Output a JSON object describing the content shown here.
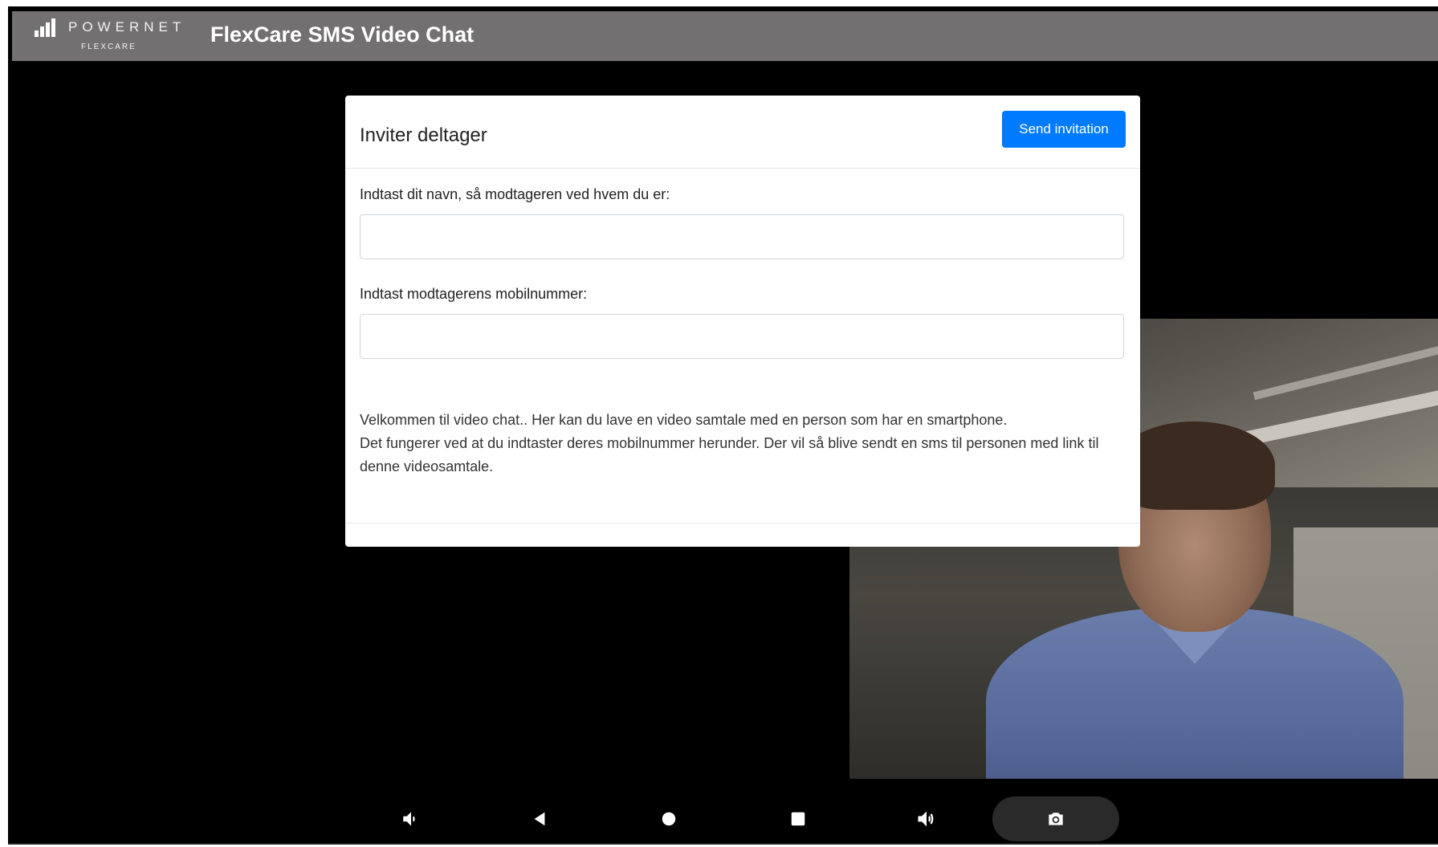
{
  "header": {
    "brand_name": "POWERNET",
    "brand_sub": "FLEXCARE",
    "app_title": "FlexCare SMS Video Chat"
  },
  "dialog": {
    "title": "Inviter deltager",
    "send_button_label": "Send invitation",
    "name_label": "Indtast dit navn, så modtageren ved hvem du er:",
    "name_value": "",
    "phone_label": "Indtast modtagerens mobilnummer:",
    "phone_value": "",
    "description_lines": [
      "Velkommen til video chat.. Her kan du lave en video samtale med en person som har en smartphone.",
      "Det fungerer ved at du indtaster deres mobilnummer herunder. Der vil så blive sendt en sms til personen med link til",
      "denne videosamtale."
    ]
  },
  "navbar": {
    "buttons": [
      {
        "name": "volume-down-icon",
        "glyph": "🔈"
      },
      {
        "name": "back-icon",
        "glyph": "◀"
      },
      {
        "name": "home-icon",
        "glyph": "●"
      },
      {
        "name": "recents-icon",
        "glyph": "■"
      },
      {
        "name": "volume-up-icon",
        "glyph": "🔊"
      },
      {
        "name": "camera-icon",
        "glyph": "📷"
      }
    ]
  },
  "colors": {
    "header_bg": "#727070",
    "primary_button": "#007bff",
    "background": "#000000"
  }
}
